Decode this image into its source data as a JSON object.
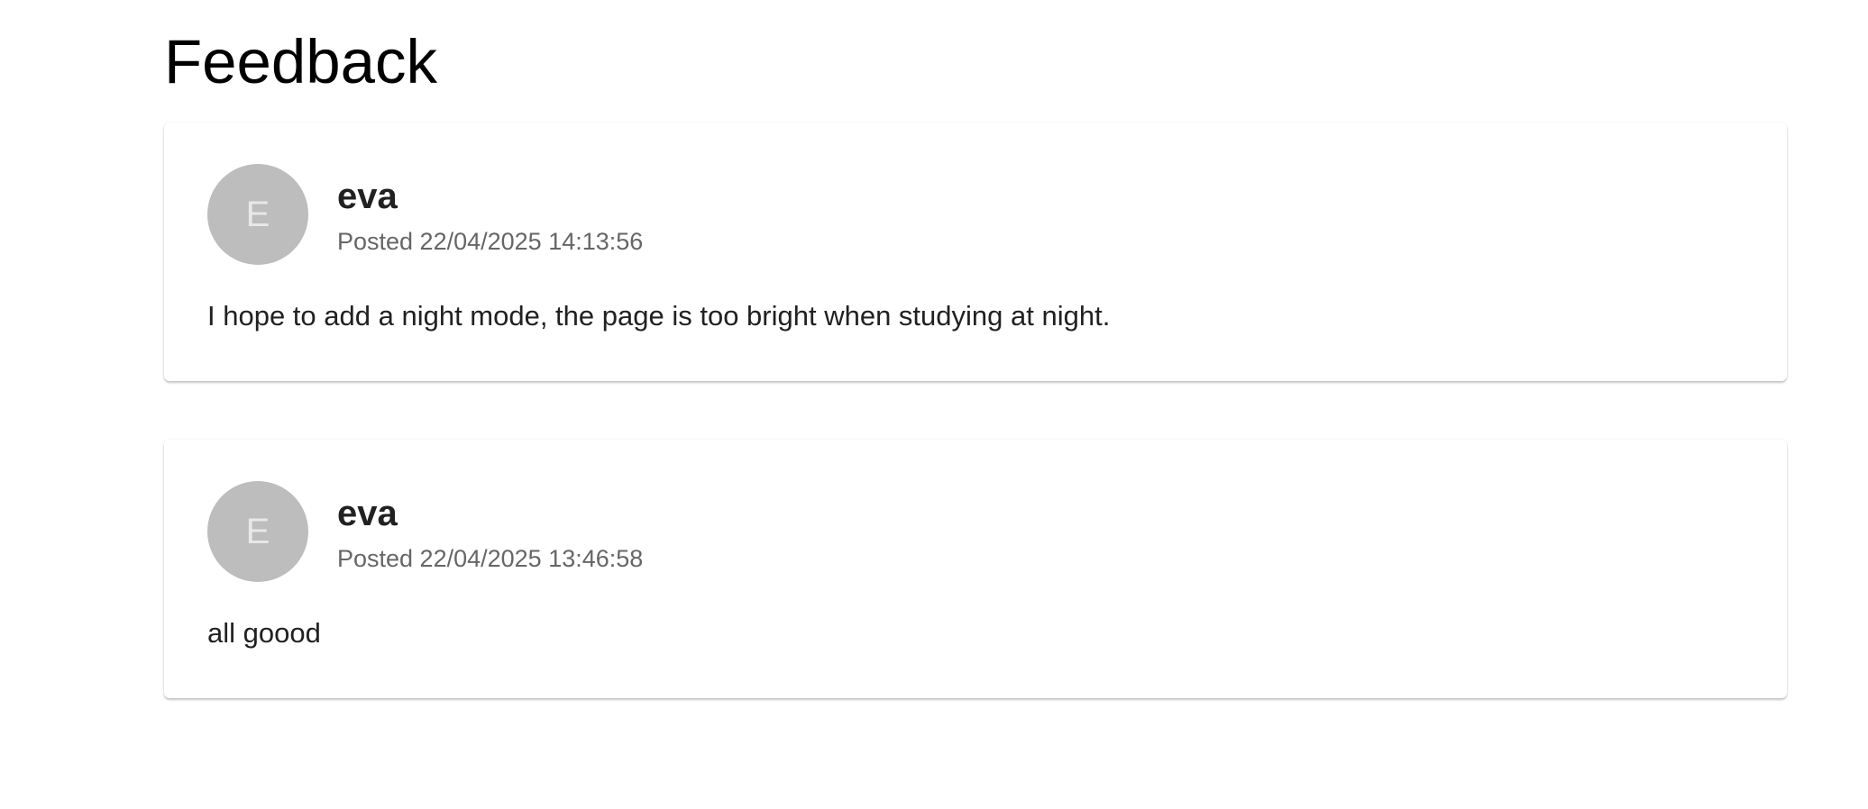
{
  "page": {
    "title": "Feedback"
  },
  "feedback": [
    {
      "avatar_initial": "E",
      "author": "eva",
      "posted": "Posted 22/04/2025 14:13:56",
      "text": "I hope to add a night mode, the page is too bright when studying at night."
    },
    {
      "avatar_initial": "E",
      "author": "eva",
      "posted": "Posted 22/04/2025 13:46:58",
      "text": "all goood"
    }
  ],
  "colors": {
    "avatar_bg": "#bdbdbd",
    "meta_text": "#666666",
    "body_text": "#212121"
  }
}
